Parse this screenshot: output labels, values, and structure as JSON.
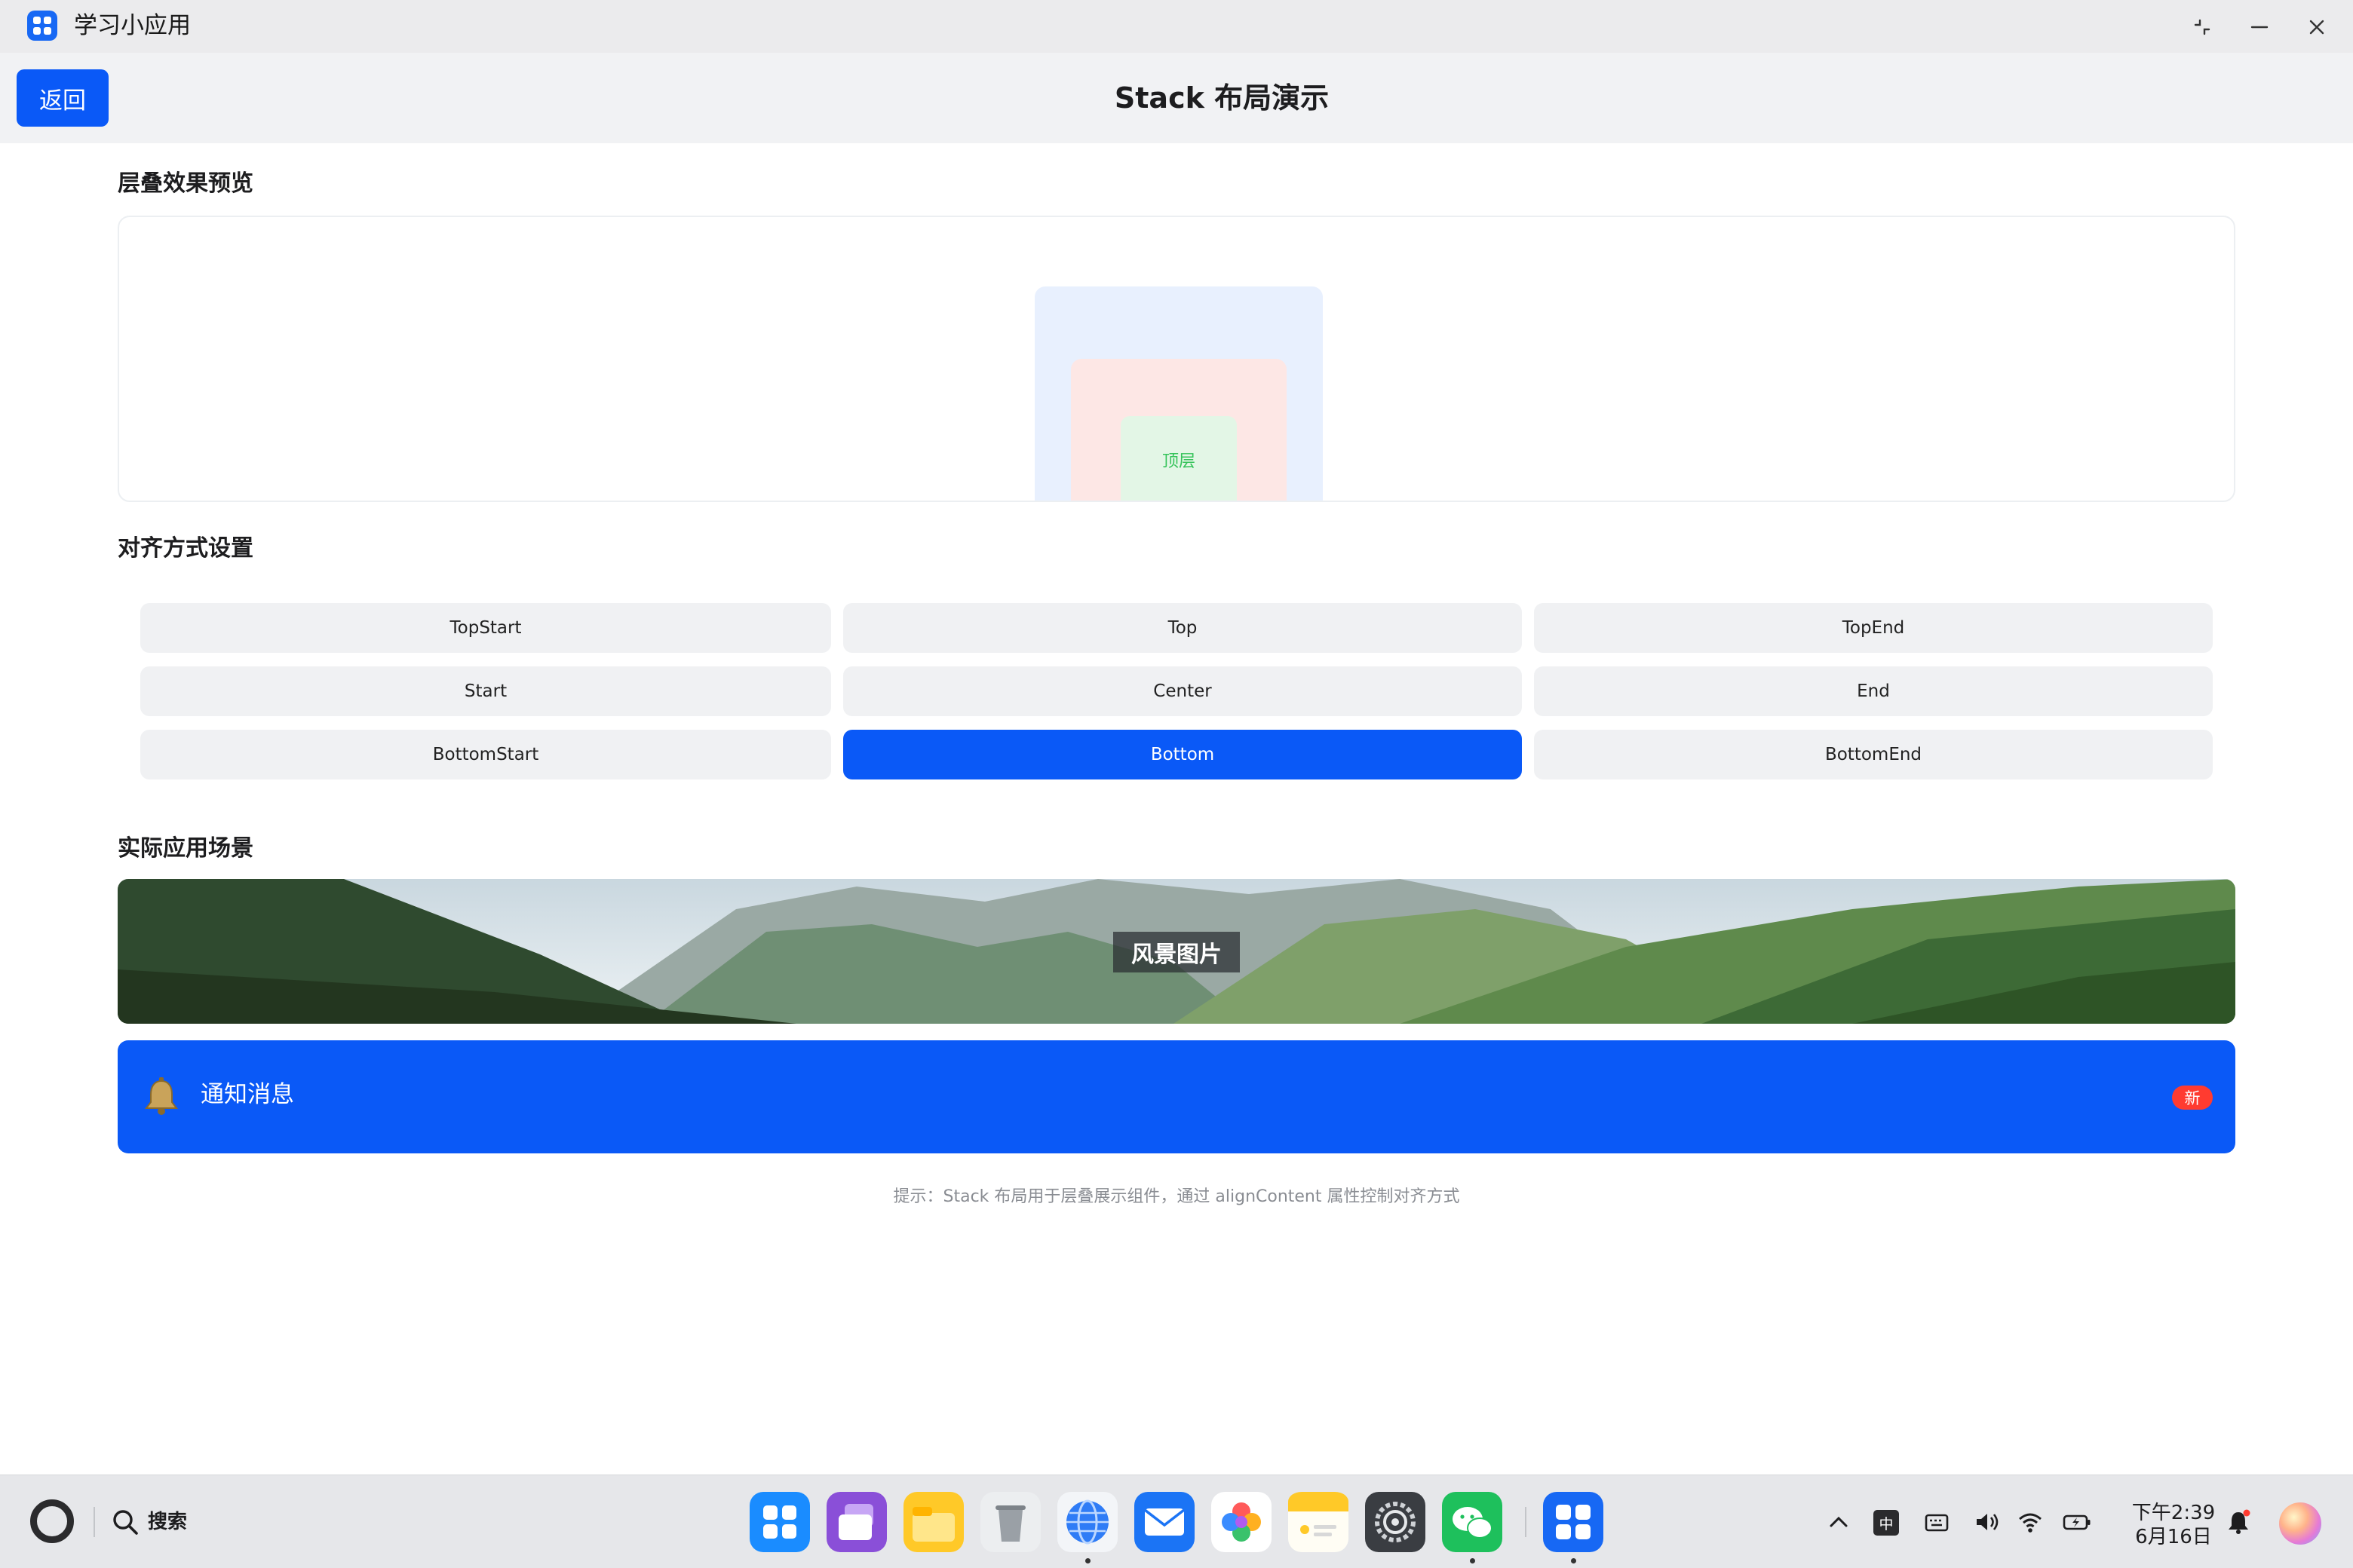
{
  "window": {
    "app_title": "学习小应用"
  },
  "header": {
    "back_label": "返回",
    "page_title": "Stack 布局演示"
  },
  "preview": {
    "heading": "层叠效果预览",
    "top_layer_label": "顶层"
  },
  "alignment": {
    "heading": "对齐方式设置",
    "options": [
      "TopStart",
      "Top",
      "TopEnd",
      "Start",
      "Center",
      "End",
      "BottomStart",
      "Bottom",
      "BottomEnd"
    ],
    "selected": "Bottom"
  },
  "scenario": {
    "heading": "实际应用场景",
    "scenery_label": "风景图片",
    "notice_icon": "bell-icon",
    "notice_text": "通知消息",
    "notice_badge": "新"
  },
  "hint": "提示：Stack 布局用于层叠展示组件，通过 alignContent 属性控制对齐方式",
  "taskbar": {
    "search_label": "搜索",
    "dock": [
      "app-grid-icon",
      "multitask-icon",
      "files-icon",
      "trash-icon",
      "browser-icon",
      "mail-icon",
      "gallery-icon",
      "notes-icon",
      "settings-icon",
      "wechat-icon",
      "learning-app-icon"
    ],
    "ime_label": "中",
    "clock_time": "下午2:39",
    "clock_date": "6月16日"
  },
  "colors": {
    "accent": "#0a59f7",
    "badge": "#ff3b30",
    "top_layer_text": "#35c35a"
  }
}
